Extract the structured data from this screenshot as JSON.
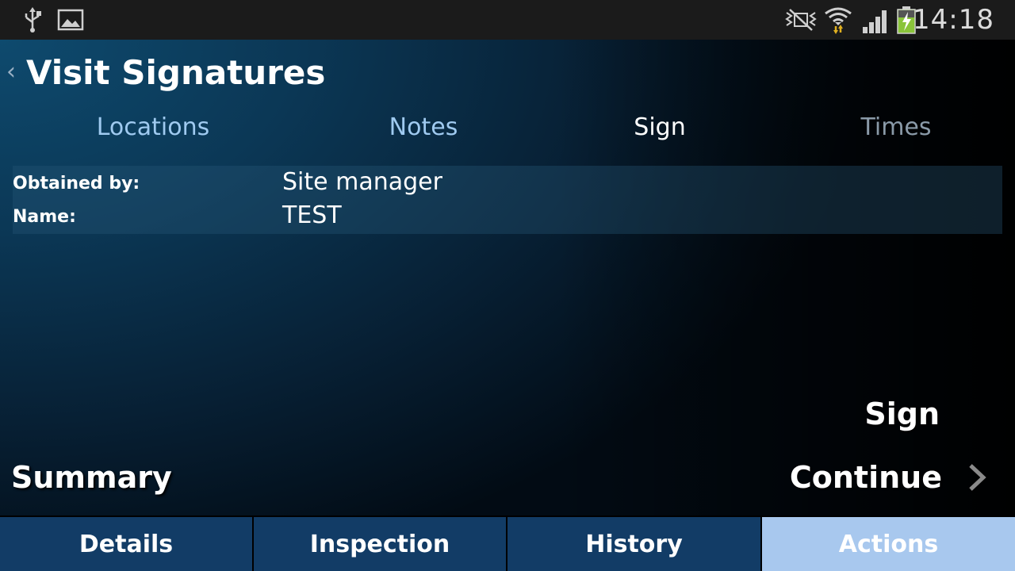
{
  "status_bar": {
    "time": "14:18",
    "icons": [
      "usb-icon",
      "image-icon",
      "nfc-mute-icon",
      "wifi-icon",
      "signal-icon",
      "battery-charging-icon"
    ]
  },
  "header": {
    "title": "Visit Signatures",
    "back_icon": "chevron-left-icon"
  },
  "tabs": [
    {
      "label": "Locations"
    },
    {
      "label": "Notes"
    },
    {
      "label": "Sign"
    },
    {
      "label": "Times"
    }
  ],
  "info": {
    "obtained_by_label": "Obtained by:",
    "obtained_by_value": "Site manager",
    "name_label": "Name:",
    "name_value": "TEST"
  },
  "actions": {
    "sign_label": "Sign",
    "summary_label": "Summary",
    "continue_label": "Continue"
  },
  "bottom_nav": [
    {
      "label": "Details"
    },
    {
      "label": "Inspection"
    },
    {
      "label": "History"
    },
    {
      "label": "Actions"
    }
  ],
  "colors": {
    "active_nav": "#a8c8ee",
    "inactive_nav": "#123c66",
    "tab_link": "#9fcaf0",
    "tab_disabled": "#8a9aa8"
  }
}
